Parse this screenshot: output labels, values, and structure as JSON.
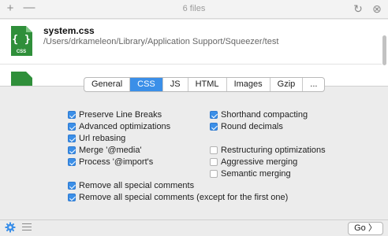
{
  "titlebar": {
    "title": "6 files",
    "add_glyph": "+",
    "remove_glyph": "—",
    "refresh_glyph": "↻",
    "close_glyph": "⊗"
  },
  "file": {
    "name": "system.css",
    "path": "/Users/drkameleon/Library/Application Support/Squeezer/test",
    "icon_label": "CSS",
    "icon_color": "#2f8f3a"
  },
  "tabs": [
    {
      "label": "General",
      "active": false
    },
    {
      "label": "CSS",
      "active": true
    },
    {
      "label": "JS",
      "active": false
    },
    {
      "label": "HTML",
      "active": false
    },
    {
      "label": "Images",
      "active": false
    },
    {
      "label": "Gzip",
      "active": false
    },
    {
      "label": "...",
      "active": false
    }
  ],
  "options": {
    "preserve_line_breaks": {
      "label": "Preserve Line Breaks",
      "checked": true
    },
    "advanced_optimizations": {
      "label": "Advanced optimizations",
      "checked": true
    },
    "url_rebasing": {
      "label": "Url rebasing",
      "checked": true
    },
    "merge_media": {
      "label": "Merge '@media'",
      "checked": true
    },
    "process_import": {
      "label": "Process '@import's",
      "checked": true
    },
    "shorthand_compacting": {
      "label": "Shorthand compacting",
      "checked": true
    },
    "round_decimals": {
      "label": "Round decimals",
      "checked": true
    },
    "restructuring_optimizations": {
      "label": "Restructuring optimizations",
      "checked": false
    },
    "aggressive_merging": {
      "label": "Aggressive merging",
      "checked": false
    },
    "semantic_merging": {
      "label": "Semantic merging",
      "checked": false
    },
    "remove_all_comments": {
      "label": "Remove all special comments",
      "checked": true
    },
    "remove_all_except_first": {
      "label": "Remove all special comments (except for the first one)",
      "checked": true
    }
  },
  "bottom": {
    "go_label": "Go  〉",
    "accent": "#3b8fe8"
  }
}
